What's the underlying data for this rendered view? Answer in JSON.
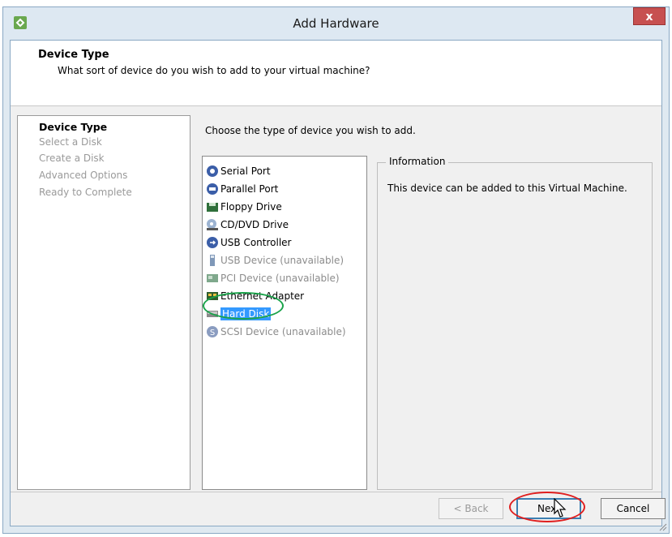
{
  "window": {
    "title": "Add Hardware",
    "close_label": "x"
  },
  "header": {
    "title": "Device Type",
    "subtitle": "What sort of device do you wish to add to your virtual machine?"
  },
  "steps": [
    {
      "label": "Device Type",
      "active": true
    },
    {
      "label": "Select a Disk",
      "active": false
    },
    {
      "label": "Create a Disk",
      "active": false
    },
    {
      "label": "Advanced Options",
      "active": false
    },
    {
      "label": "Ready to Complete",
      "active": false
    }
  ],
  "prompt": "Choose the type of device you wish to add.",
  "devices": [
    {
      "label": "Serial Port",
      "icon": "serial-port-icon",
      "available": true,
      "selected": false
    },
    {
      "label": "Parallel Port",
      "icon": "parallel-port-icon",
      "available": true,
      "selected": false
    },
    {
      "label": "Floppy Drive",
      "icon": "floppy-drive-icon",
      "available": true,
      "selected": false
    },
    {
      "label": "CD/DVD Drive",
      "icon": "cd-dvd-drive-icon",
      "available": true,
      "selected": false
    },
    {
      "label": "USB Controller",
      "icon": "usb-controller-icon",
      "available": true,
      "selected": false
    },
    {
      "label": "USB Device (unavailable)",
      "icon": "usb-device-icon",
      "available": false,
      "selected": false
    },
    {
      "label": "PCI Device (unavailable)",
      "icon": "pci-device-icon",
      "available": false,
      "selected": false
    },
    {
      "label": "Ethernet Adapter",
      "icon": "ethernet-adapter-icon",
      "available": true,
      "selected": false
    },
    {
      "label": "Hard Disk",
      "icon": "hard-disk-icon",
      "available": true,
      "selected": true
    },
    {
      "label": "SCSI Device (unavailable)",
      "icon": "scsi-device-icon",
      "available": false,
      "selected": false
    }
  ],
  "info": {
    "legend": "Information",
    "text": "This device can be added to this Virtual Machine."
  },
  "buttons": {
    "back": "< Back",
    "next": "Next",
    "cancel": "Cancel"
  },
  "colors": {
    "selection": "#3399ff",
    "annotation_green": "#1aa34a",
    "annotation_red": "#e01e1e",
    "close_button": "#c75050"
  }
}
